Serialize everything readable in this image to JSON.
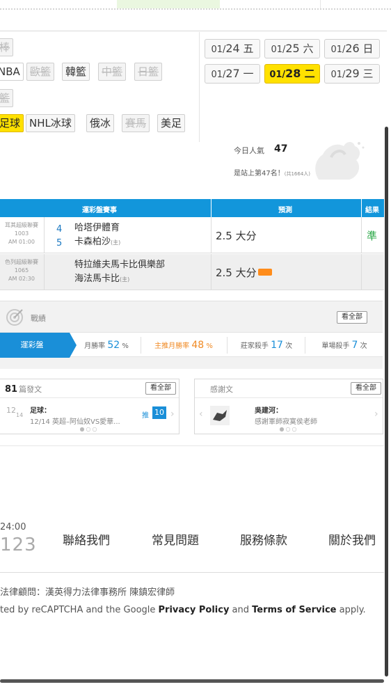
{
  "sport_tags": {
    "row1": [
      {
        "label": "棒",
        "disabled": true
      }
    ],
    "row2": [
      {
        "label": "NBA",
        "disabled": false
      },
      {
        "label": "歐籃",
        "disabled": true
      },
      {
        "label": "韓籃",
        "disabled": false
      },
      {
        "label": "中籃",
        "disabled": true
      },
      {
        "label": "日籃",
        "disabled": true
      }
    ],
    "row3": [
      {
        "label": "籃",
        "disabled": true
      }
    ],
    "row4": [
      {
        "label": "足球",
        "active": true
      },
      {
        "label": "NHL冰球",
        "disabled": false
      },
      {
        "label": "俄冰",
        "disabled": false
      },
      {
        "label": "賽馬",
        "disabled": true
      },
      {
        "label": "美足",
        "disabled": false
      }
    ]
  },
  "dates": [
    {
      "m": "01/",
      "d": "24",
      "w": "五",
      "active": false
    },
    {
      "m": "01/",
      "d": "25",
      "w": "六",
      "active": false
    },
    {
      "m": "01/",
      "d": "26",
      "w": "日",
      "active": false
    },
    {
      "m": "01/",
      "d": "27",
      "w": "一",
      "active": false
    },
    {
      "m": "01/",
      "d": "28",
      "w": "二",
      "active": true
    },
    {
      "m": "01/",
      "d": "29",
      "w": "三",
      "active": false
    }
  ],
  "popularity": {
    "label": "今日人氣",
    "value": "47",
    "rank_text": "是站上第47名！",
    "rank_small": "(共1664人)"
  },
  "table": {
    "headers": {
      "event": "運彩盤賽事",
      "prediction": "預測",
      "result": "結果"
    },
    "rows": [
      {
        "league": "耳其超級聯賽",
        "code": "1003",
        "time": "AM 01:00",
        "num1": "4",
        "num2": "5",
        "team1": "哈塔伊體育",
        "team2": "卡森柏沙",
        "home_mark": "(主)",
        "prediction": "2.5 大分",
        "result": "準",
        "hot": false
      },
      {
        "league": "色列超級聯賽",
        "code": "1065",
        "time": "AM 02:30",
        "num1": "",
        "num2": "",
        "team1": "特拉維夫馬卡比俱樂部",
        "team2": "海法馬卡比",
        "home_mark": "(主)",
        "prediction": "2.5 大分",
        "result": "",
        "hot": true
      }
    ]
  },
  "record": {
    "title": "戰績",
    "view_all": "看全部",
    "active_tab": "運彩盤",
    "stats": [
      {
        "label": "月勝率",
        "value": "52",
        "unit": "%",
        "style": "blue"
      },
      {
        "label": "主推月勝率",
        "value": "48",
        "unit": "%",
        "style": "orange"
      },
      {
        "label": "莊家殺手",
        "value": "17",
        "unit": "次",
        "style": "blue"
      },
      {
        "label": "單場殺手",
        "value": "7",
        "unit": "次",
        "style": "blue"
      }
    ]
  },
  "posts": {
    "count": "81",
    "count_label": "篇發文",
    "view_all": "看全部",
    "date_a": "12",
    "date_b": "14",
    "category": "足球：",
    "snippet": "12/14 英超–阿仙奴VS愛華...",
    "push_label": "推",
    "push_count": "10"
  },
  "thanks": {
    "title": "感謝文",
    "view_all": "看全部",
    "author": "吳建河：",
    "snippet": "感謝軍師寂寞侯老師"
  },
  "footer": {
    "time": "24:00",
    "number": "123",
    "links": [
      "聯絡我們",
      "常見問題",
      "服務條款",
      "關於我們"
    ],
    "legal": "法律顧問：漢英得力法律事務所 陳鎮宏律師",
    "captcha_pre": "ted by reCAPTCHA and the Google ",
    "privacy": "Privacy Policy",
    "and": " and ",
    "terms": "Terms of Service",
    "apply": " apply."
  },
  "colors": {
    "accent": "#1296db",
    "active": "#ffe100",
    "win": "#28a745",
    "orange": "#f08a24"
  }
}
